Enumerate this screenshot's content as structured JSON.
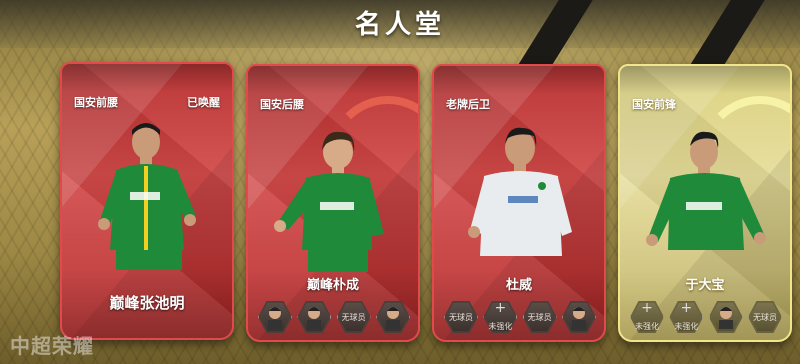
{
  "screen": {
    "title": "名人堂",
    "watermark": "中超荣耀"
  },
  "cards": [
    {
      "position": "国安前腰",
      "status": "已唤醒",
      "name": "巅峰张池明",
      "slots": []
    },
    {
      "position": "国安后腰",
      "status": "",
      "name": "巅峰朴成",
      "slots": [
        {
          "type": "player",
          "label": "",
          "icon": "player-portrait"
        },
        {
          "type": "player",
          "label": "",
          "icon": "player-portrait"
        },
        {
          "type": "empty",
          "label": "无球员",
          "icon": ""
        },
        {
          "type": "player",
          "label": "",
          "icon": "player-portrait"
        }
      ]
    },
    {
      "position": "老牌后卫",
      "status": "",
      "name": "杜威",
      "slots": [
        {
          "type": "empty",
          "label": "无球员",
          "icon": ""
        },
        {
          "type": "plus",
          "label": "未强化",
          "icon": "plus-icon"
        },
        {
          "type": "empty",
          "label": "无球员",
          "icon": ""
        },
        {
          "type": "player",
          "label": "",
          "icon": "player-portrait"
        }
      ]
    },
    {
      "position": "国安前锋",
      "status": "",
      "name": "于大宝",
      "slots": [
        {
          "type": "plus",
          "label": "未强化",
          "icon": "plus-icon"
        },
        {
          "type": "plus",
          "label": "未强化",
          "icon": "plus-icon"
        },
        {
          "type": "player",
          "label": "",
          "icon": "player-portrait"
        },
        {
          "type": "empty",
          "label": "无球员",
          "icon": ""
        }
      ]
    }
  ],
  "colors": {
    "red_card": "#c23636",
    "gold_card": "#d9cf7a",
    "kit_green": "#1f8a3a"
  }
}
